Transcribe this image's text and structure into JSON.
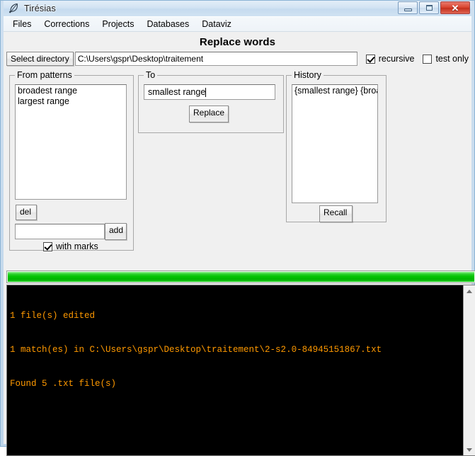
{
  "window": {
    "title": "Tirésias",
    "icon": "quill-feather-icon",
    "controls": {
      "minimize": "minimize-icon",
      "maximize": "maximize-icon",
      "close": "✕"
    }
  },
  "menubar": {
    "items": [
      {
        "label": "Files"
      },
      {
        "label": "Corrections"
      },
      {
        "label": "Projects"
      },
      {
        "label": "Databases"
      },
      {
        "label": "Dataviz"
      }
    ]
  },
  "page": {
    "title": "Replace words"
  },
  "directory_row": {
    "select_button": "Select directory",
    "path_value": "C:\\Users\\gspr\\Desktop\\traitement",
    "path_placeholder": "",
    "recursive_label": "recursive",
    "recursive_checked": true,
    "test_only_label": "test only",
    "test_only_checked": false
  },
  "from_patterns": {
    "legend": "From patterns",
    "items": [
      {
        "text": "broadest range"
      },
      {
        "text": "largest range"
      }
    ],
    "del_label": "del",
    "add_input_value": "",
    "add_input_placeholder": "",
    "add_label": "add",
    "with_marks_label": "with marks",
    "with_marks_checked": true
  },
  "to_panel": {
    "legend": "To",
    "input_value": "smallest range",
    "input_placeholder": "",
    "replace_label": "Replace"
  },
  "history": {
    "legend": "History",
    "items": [
      {
        "text": "{smallest range} {broad"
      }
    ],
    "recall_label": "Recall"
  },
  "progress": {
    "percent": 100,
    "fill_color": "#00b400"
  },
  "console": {
    "text_color": "#ff9900",
    "background": "#000000",
    "lines": [
      "1 file(s) edited",
      "1 match(es) in C:\\Users\\gspr\\Desktop\\traitement\\2-s2.0-84945151867.txt",
      "Found 5 .txt file(s)"
    ]
  }
}
